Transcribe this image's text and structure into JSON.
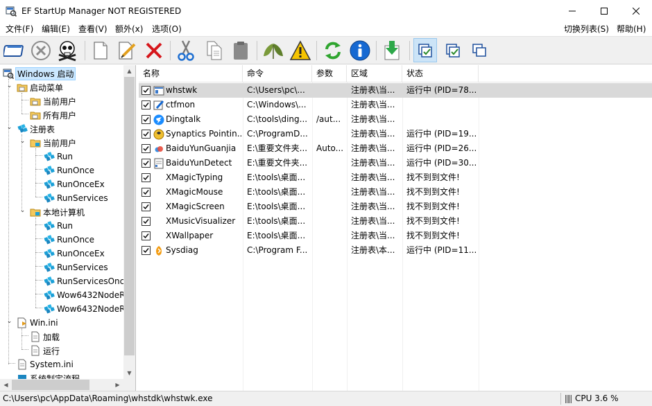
{
  "window": {
    "title": "EF StartUp Manager NOT REGISTERED",
    "minimize_glyph": "—",
    "maximize_glyph": "☐",
    "close_glyph": "✕"
  },
  "menu": {
    "file": "文件(F)",
    "edit": "编辑(E)",
    "view": "查看(V)",
    "extra": "额外(x)",
    "options": "选项(O)",
    "switch_list": "切换列表(S)",
    "help": "帮助(H)"
  },
  "toolbar": {
    "buttons": [
      {
        "name": "open-icon"
      },
      {
        "name": "disable-icon"
      },
      {
        "name": "skull-icon"
      },
      {
        "name": "new-icon"
      },
      {
        "name": "edit-icon"
      },
      {
        "name": "delete-icon"
      },
      {
        "name": "cut-icon"
      },
      {
        "name": "copy-icon"
      },
      {
        "name": "paste-icon"
      },
      {
        "name": "leaf-icon"
      },
      {
        "name": "warning-icon"
      },
      {
        "name": "refresh-icon"
      },
      {
        "name": "info-icon"
      },
      {
        "name": "download-icon"
      },
      {
        "name": "checked-view-icon"
      },
      {
        "name": "checklist-icon"
      },
      {
        "name": "windows-icon"
      }
    ]
  },
  "tree": {
    "items": [
      {
        "label": "Windows 启动"
      },
      {
        "label": "启动菜单"
      },
      {
        "label": "当前用户"
      },
      {
        "label": "所有用户"
      },
      {
        "label": "注册表"
      },
      {
        "label": "当前用户"
      },
      {
        "label": "Run"
      },
      {
        "label": "RunOnce"
      },
      {
        "label": "RunOnceEx"
      },
      {
        "label": "RunServices"
      },
      {
        "label": "本地计算机"
      },
      {
        "label": "Run"
      },
      {
        "label": "RunOnce"
      },
      {
        "label": "RunOnceEx"
      },
      {
        "label": "RunServices"
      },
      {
        "label": "RunServicesOnc"
      },
      {
        "label": "Wow6432NodeR"
      },
      {
        "label": "Wow6432NodeR"
      },
      {
        "label": "Win.ini"
      },
      {
        "label": "加载"
      },
      {
        "label": "运行"
      },
      {
        "label": "System.ini"
      },
      {
        "label": "系统制定流程"
      }
    ]
  },
  "list": {
    "columns": [
      "名称",
      "命令",
      "参数",
      "区域",
      "状态"
    ],
    "rows": [
      {
        "name": "whstwk",
        "command": "C:\\Users\\pc\\...",
        "params": "",
        "area": "注册表\\当...",
        "status": "运行中 (PID=78..."
      },
      {
        "name": "ctfmon",
        "command": "C:\\Windows\\...",
        "params": "",
        "area": "注册表\\当...",
        "status": ""
      },
      {
        "name": "Dingtalk",
        "command": "C:\\tools\\ding...",
        "params": "/aut...",
        "area": "注册表\\当...",
        "status": ""
      },
      {
        "name": "Synaptics Pointin...",
        "command": "C:\\ProgramD...",
        "params": "",
        "area": "注册表\\当...",
        "status": "运行中 (PID=19..."
      },
      {
        "name": "BaiduYunGuanjia",
        "command": "E:\\重要文件夹...",
        "params": "Auto...",
        "area": "注册表\\当...",
        "status": "运行中 (PID=26..."
      },
      {
        "name": "BaiduYunDetect",
        "command": "E:\\重要文件夹...",
        "params": "",
        "area": "注册表\\当...",
        "status": "运行中 (PID=30..."
      },
      {
        "name": "XMagicTyping",
        "command": "E:\\tools\\桌面...",
        "params": "",
        "area": "注册表\\当...",
        "status": "找不到到文件!"
      },
      {
        "name": "XMagicMouse",
        "command": "E:\\tools\\桌面...",
        "params": "",
        "area": "注册表\\当...",
        "status": "找不到到文件!"
      },
      {
        "name": "XMagicScreen",
        "command": "E:\\tools\\桌面...",
        "params": "",
        "area": "注册表\\当...",
        "status": "找不到到文件!"
      },
      {
        "name": "XMusicVisualizer",
        "command": "E:\\tools\\桌面...",
        "params": "",
        "area": "注册表\\当...",
        "status": "找不到到文件!"
      },
      {
        "name": "XWallpaper",
        "command": "E:\\tools\\桌面...",
        "params": "",
        "area": "注册表\\当...",
        "status": "找不到到文件!"
      },
      {
        "name": "Sysdiag",
        "command": "C:\\Program F...",
        "params": "",
        "area": "注册表\\本...",
        "status": "运行中 (PID=11..."
      }
    ]
  },
  "status": {
    "path": "C:\\Users\\pc\\AppData\\Roaming\\whstdk\\whstwk.exe",
    "cpu": "CPU 3.6 %"
  },
  "colors": {
    "selection": "#cce8ff",
    "row_selected": "#d9d9d9",
    "toolbar_bg": "#f0f0f0",
    "active_button": "#cce4f7"
  }
}
